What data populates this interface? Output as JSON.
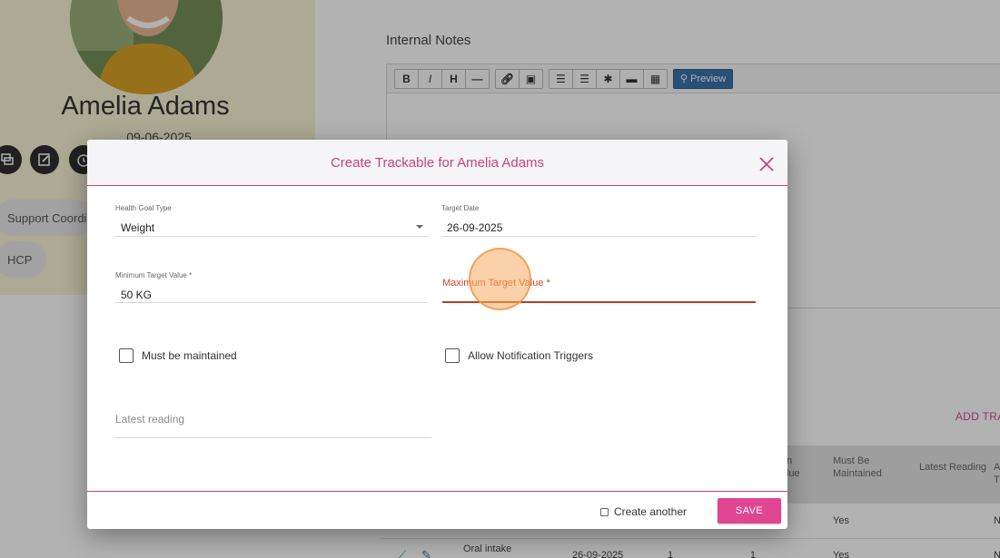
{
  "profile": {
    "name": "Amelia Adams",
    "dob": "09-06-2025",
    "pills": [
      "Support Coordin",
      "HCP"
    ]
  },
  "notes": {
    "label": "Internal Notes",
    "toolbar": {
      "buttons": [
        "B",
        "I",
        "H",
        "—"
      ],
      "preview_label": "Preview"
    }
  },
  "page": {
    "add_link": "ADD TRA",
    "table_headers": [
      "n",
      "lue",
      "Must Be",
      "Maintained",
      "Latest Reading",
      "A",
      "T"
    ],
    "rows": [
      {
        "col1": "Yes",
        "col2": "N"
      },
      {
        "name": "Oral intake",
        "date": "26-09-2025",
        "a": "1",
        "b": "1",
        "maintained": "Yes",
        "last": "N"
      }
    ]
  },
  "modal": {
    "title": "Create Trackable for Amelia Adams",
    "fields": {
      "goal_type_label": "Health Goal Type",
      "goal_type_value": "Weight",
      "target_date_label": "Target Date",
      "target_date_value": "26-09-2025",
      "min_label": "Minimum Target Value *",
      "min_value": "50 KG",
      "max_label": "Maximum Target Value *",
      "latest_placeholder": "Latest reading"
    },
    "checks": {
      "maintained_label": "Must be maintained",
      "notify_label": "Allow Notification Triggers"
    },
    "footer": {
      "create_another_label": "Create another",
      "save_label": "SAVE"
    }
  },
  "colors": {
    "accent": "#c9427f",
    "save": "#e04592",
    "error": "#c94a2e",
    "preview": "#3a72a8"
  }
}
